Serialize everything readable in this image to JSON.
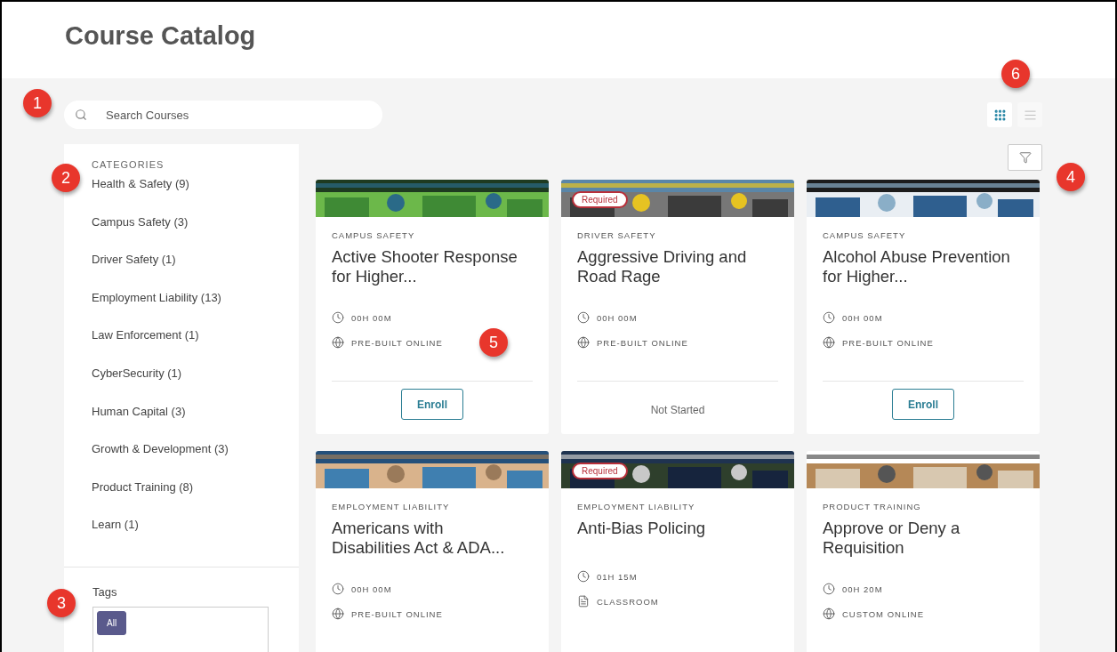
{
  "page_title": "Course Catalog",
  "search": {
    "placeholder": "Search Courses"
  },
  "view_toggle": [
    {
      "kind": "grid",
      "selected": true
    },
    {
      "kind": "list",
      "selected": false
    }
  ],
  "sidebar": {
    "categories_heading": "CATEGORIES",
    "categories": [
      "Health & Safety (9)",
      "Campus Safety (3)",
      "Driver Safety (1)",
      "Employment Liability (13)",
      "Law Enforcement (1)",
      "CyberSecurity (1)",
      "Human Capital (3)",
      "Growth & Development (3)",
      "Product Training (8)",
      "Learn (1)"
    ],
    "tags_heading": "Tags",
    "tags": [
      {
        "label": "All",
        "selected": true
      }
    ]
  },
  "courses": [
    {
      "category": "CAMPUS SAFETY",
      "title": "Active Shooter Response for Higher...",
      "required": false,
      "duration": "00H 00M",
      "delivery": {
        "kind": "online",
        "label": "PRE-BUILT ONLINE"
      },
      "action": {
        "kind": "button",
        "label": "Enroll"
      }
    },
    {
      "category": "DRIVER SAFETY",
      "title": "Aggressive Driving and Road Rage",
      "required": true,
      "required_label": "Required",
      "duration": "00H 00M",
      "delivery": {
        "kind": "online",
        "label": "PRE-BUILT ONLINE"
      },
      "action": {
        "kind": "status",
        "label": "Not Started"
      }
    },
    {
      "category": "CAMPUS SAFETY",
      "title": "Alcohol Abuse Prevention for Higher...",
      "required": false,
      "duration": "00H 00M",
      "delivery": {
        "kind": "online",
        "label": "PRE-BUILT ONLINE"
      },
      "action": {
        "kind": "button",
        "label": "Enroll"
      }
    },
    {
      "category": "EMPLOYMENT LIABILITY",
      "title": "Americans with Disabilities Act & ADA...",
      "required": false,
      "duration": "00H 00M",
      "delivery": {
        "kind": "online",
        "label": "PRE-BUILT ONLINE"
      }
    },
    {
      "category": "EMPLOYMENT LIABILITY",
      "title": "Anti-Bias Policing",
      "required": true,
      "required_label": "Required",
      "duration": "01H 15M",
      "delivery": {
        "kind": "classroom",
        "label": "CLASSROOM"
      }
    },
    {
      "category": "PRODUCT TRAINING",
      "title": "Approve or Deny a Requisition",
      "required": false,
      "duration": "00H 20M",
      "delivery": {
        "kind": "online",
        "label": "CUSTOM ONLINE"
      }
    }
  ],
  "callouts": [
    "1",
    "2",
    "3",
    "4",
    "5",
    "6"
  ]
}
